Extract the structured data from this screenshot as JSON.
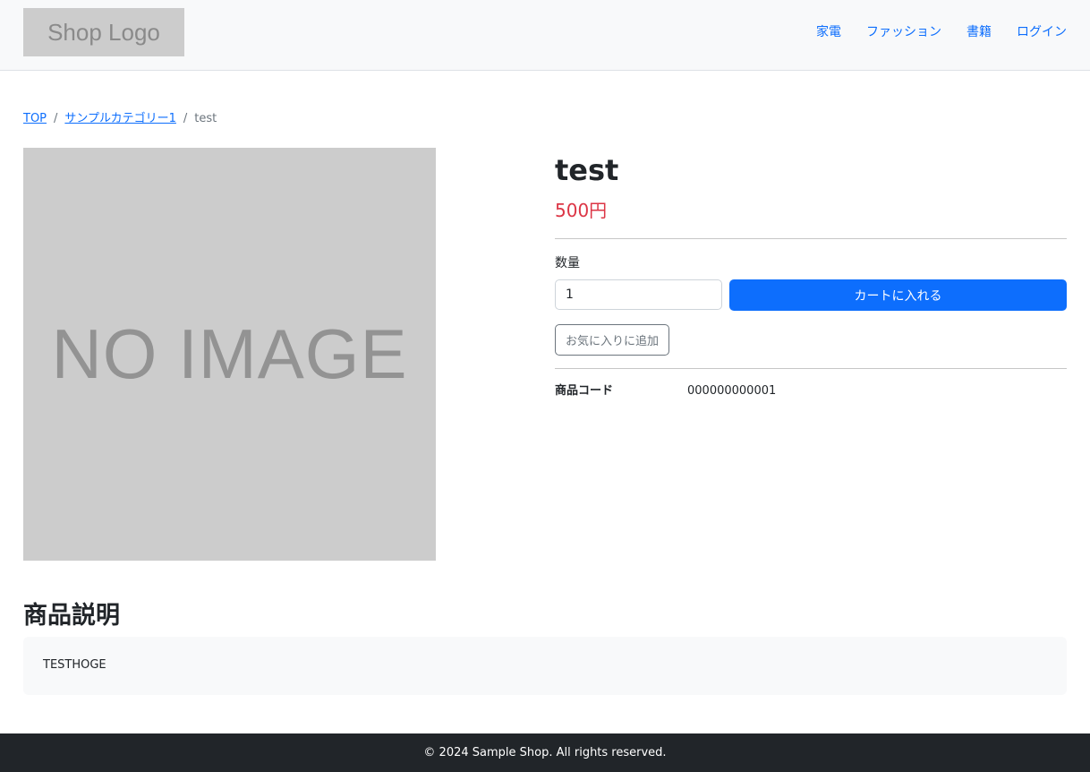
{
  "header": {
    "logo_text": "Shop Logo",
    "nav": [
      "家電",
      "ファッション",
      "書籍",
      "ログイン"
    ]
  },
  "breadcrumb": {
    "items": [
      "TOP",
      "サンプルカテゴリー1"
    ],
    "separator": "/",
    "current": "test"
  },
  "product": {
    "image_placeholder": "NO IMAGE",
    "title": "test",
    "price": "500円",
    "quantity_label": "数量",
    "quantity_value": "1",
    "add_to_cart_label": "カートに入れる",
    "add_to_favorites_label": "お気に入りに追加",
    "spec_label": "商品コード",
    "spec_value": "000000000001"
  },
  "description": {
    "heading": "商品説明",
    "text": "TESTHOGE"
  },
  "footer": {
    "copyright": "© 2024 Sample Shop. All rights reserved."
  },
  "colors": {
    "primary": "#0d6efd",
    "price": "#dc3545",
    "footer_bg": "#212529",
    "header_bg": "#f8f9fa",
    "placeholder_bg": "#cccccc"
  }
}
